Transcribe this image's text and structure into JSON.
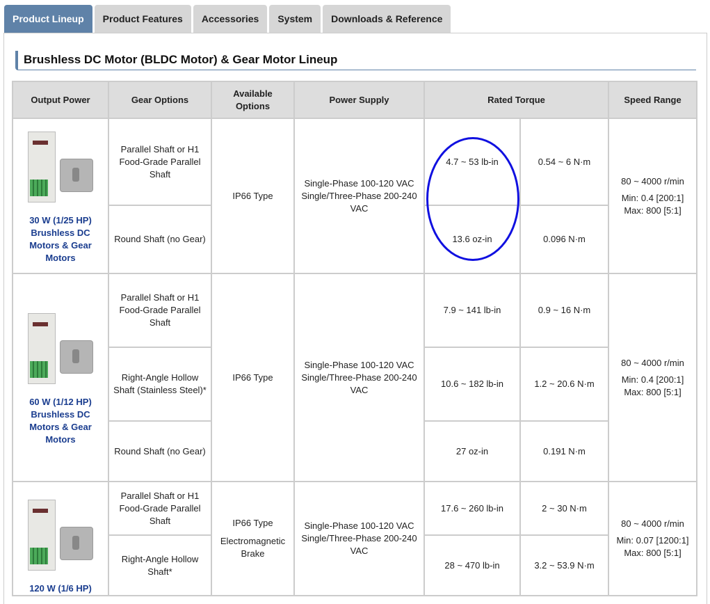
{
  "tabs": [
    {
      "label": "Product Lineup",
      "active": true
    },
    {
      "label": "Product Features"
    },
    {
      "label": "Accessories"
    },
    {
      "label": "System"
    },
    {
      "label": "Downloads & Reference"
    }
  ],
  "heading": "Brushless DC Motor (BLDC Motor) & Gear Motor Lineup",
  "table": {
    "headers": [
      "Output Power",
      "Gear Options",
      "Available Options",
      "Power Supply",
      "Rated Torque",
      "Speed Range"
    ],
    "products": [
      {
        "name": "30 W (1/25 HP) Brushless DC Motors & Gear Motors",
        "options": "IP66 Type",
        "supply": "Single-Phase 100-120 VAC Single/Three-Phase 200-240 VAC",
        "speed": "80 ~ 4000 r/min",
        "speed_min": "Min: 0.4 [200:1]",
        "speed_max": "Max: 800 [5:1]",
        "rows": [
          {
            "gear": "Parallel Shaft or H1 Food-Grade Parallel Shaft",
            "torque_imp": "4.7 ~ 53 lb-in",
            "torque_si": "0.54 ~ 6 N·m"
          },
          {
            "gear": "Round Shaft (no Gear)",
            "torque_imp": "13.6 oz-in",
            "torque_si": "0.096 N·m"
          }
        ]
      },
      {
        "name": "60 W (1/12 HP) Brushless DC Motors & Gear Motors",
        "options": "IP66 Type",
        "supply": "Single-Phase 100-120 VAC Single/Three-Phase 200-240 VAC",
        "speed": "80 ~ 4000 r/min",
        "speed_min": "Min: 0.4 [200:1]",
        "speed_max": "Max: 800 [5:1]",
        "rows": [
          {
            "gear": "Parallel Shaft or H1 Food-Grade Parallel Shaft",
            "torque_imp": "7.9 ~ 141 lb-in",
            "torque_si": "0.9 ~ 16 N·m"
          },
          {
            "gear": "Right-Angle Hollow Shaft (Stainless Steel)*",
            "torque_imp": "10.6 ~ 182 lb-in",
            "torque_si": "1.2 ~ 20.6 N·m"
          },
          {
            "gear": "Round Shaft (no Gear)",
            "torque_imp": "27 oz-in",
            "torque_si": "0.191 N·m"
          }
        ]
      },
      {
        "name": "120 W (1/6 HP)",
        "options": "IP66 Type",
        "options2": "Electromagnetic Brake",
        "supply": "Single-Phase 100-120 VAC Single/Three-Phase 200-240 VAC",
        "speed": "80 ~ 4000 r/min",
        "speed_min": "Min: 0.07 [1200:1]",
        "speed_max": "Max: 800 [5:1]",
        "rows": [
          {
            "gear": "Parallel Shaft or H1 Food-Grade Parallel Shaft",
            "torque_imp": "17.6 ~ 260 lb-in",
            "torque_si": "2 ~ 30 N·m"
          },
          {
            "gear": "Right-Angle Hollow Shaft*",
            "torque_imp": "28 ~ 470 lb-in",
            "torque_si": "3.2 ~ 53.9 N·m"
          }
        ]
      }
    ]
  },
  "annotation_color": "#1010e0"
}
